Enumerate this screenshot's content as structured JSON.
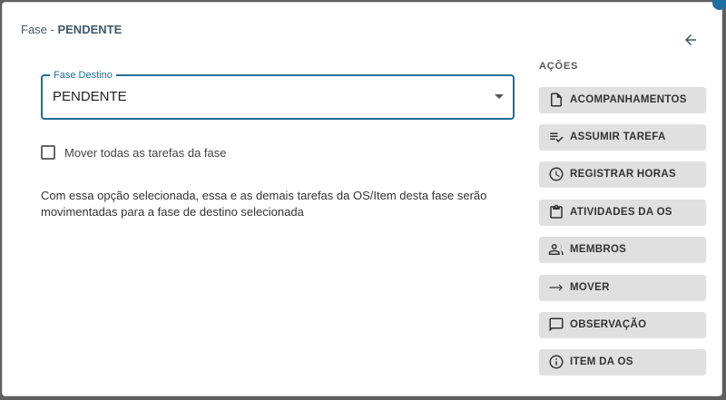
{
  "dialog": {
    "title_prefix": "Fase - ",
    "title_phase": "PENDENTE"
  },
  "field": {
    "label": "Fase Destino",
    "value": "PENDENTE"
  },
  "checkbox": {
    "label": "Mover todas as tarefas da fase",
    "checked": false
  },
  "description": "Com essa opção selecionada, essa e as demais tarefas da OS/Item desta fase serão movimentadas para a fase de destino selecionada",
  "actions": {
    "title": "AÇÕES",
    "items": [
      {
        "label": "ACOMPANHAMENTOS",
        "icon": "document-icon"
      },
      {
        "label": "ASSUMIR TAREFA",
        "icon": "playlist-check-icon"
      },
      {
        "label": "REGISTRAR HORAS",
        "icon": "clock-icon"
      },
      {
        "label": "ATIVIDADES DA OS",
        "icon": "clipboard-icon"
      },
      {
        "label": "MEMBROS",
        "icon": "people-icon"
      },
      {
        "label": "MOVER",
        "icon": "arrow-right-icon"
      },
      {
        "label": "OBSERVAÇÃO",
        "icon": "comment-icon"
      },
      {
        "label": "ITEM DA OS",
        "icon": "info-icon"
      }
    ]
  },
  "colors": {
    "accent": "#1f6e97",
    "button_bg": "#e0e0e0"
  }
}
